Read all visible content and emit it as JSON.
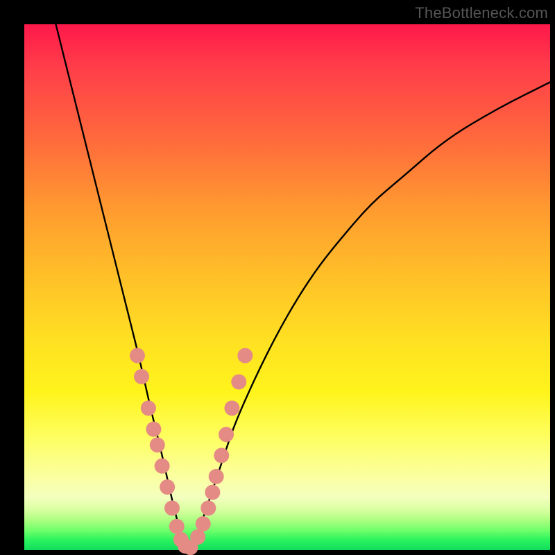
{
  "watermark": {
    "text": "TheBottleneck.com"
  },
  "chart_data": {
    "type": "line",
    "title": "",
    "xlabel": "",
    "ylabel": "",
    "xlim": [
      0,
      100
    ],
    "ylim": [
      0,
      100
    ],
    "grid": false,
    "legend": null,
    "series": [
      {
        "name": "bottleneck-curve",
        "x": [
          6,
          8,
          10,
          12,
          14,
          16,
          18,
          20,
          22,
          24,
          26,
          28,
          29,
          30,
          31,
          32,
          34,
          36,
          38,
          40,
          44,
          48,
          52,
          56,
          60,
          66,
          72,
          80,
          90,
          100
        ],
        "y": [
          100,
          92,
          84,
          76,
          68,
          60,
          52,
          44,
          36,
          27,
          19,
          10,
          6,
          2,
          0,
          1,
          6,
          12,
          18,
          24,
          33,
          41,
          48,
          54,
          59,
          66,
          71,
          78,
          84,
          89
        ]
      }
    ],
    "highlight_points": {
      "name": "dots",
      "color": "#e58b85",
      "points": [
        {
          "x": 21.5,
          "y": 37
        },
        {
          "x": 22.3,
          "y": 33
        },
        {
          "x": 23.6,
          "y": 27
        },
        {
          "x": 24.6,
          "y": 23
        },
        {
          "x": 25.3,
          "y": 20
        },
        {
          "x": 26.2,
          "y": 16
        },
        {
          "x": 27.2,
          "y": 12
        },
        {
          "x": 28.1,
          "y": 8
        },
        {
          "x": 29.0,
          "y": 4.5
        },
        {
          "x": 29.8,
          "y": 2
        },
        {
          "x": 30.6,
          "y": 0.8
        },
        {
          "x": 31.6,
          "y": 0.5
        },
        {
          "x": 33.0,
          "y": 2.5
        },
        {
          "x": 34.0,
          "y": 5
        },
        {
          "x": 35.0,
          "y": 8
        },
        {
          "x": 35.8,
          "y": 11
        },
        {
          "x": 36.5,
          "y": 14
        },
        {
          "x": 37.5,
          "y": 18
        },
        {
          "x": 38.4,
          "y": 22
        },
        {
          "x": 39.5,
          "y": 27
        },
        {
          "x": 40.8,
          "y": 32
        },
        {
          "x": 42.0,
          "y": 37
        }
      ]
    },
    "background_gradient": {
      "top_color": "#ff184a",
      "mid_color": "#ffe022",
      "bottom_color": "#11dc5c"
    }
  }
}
